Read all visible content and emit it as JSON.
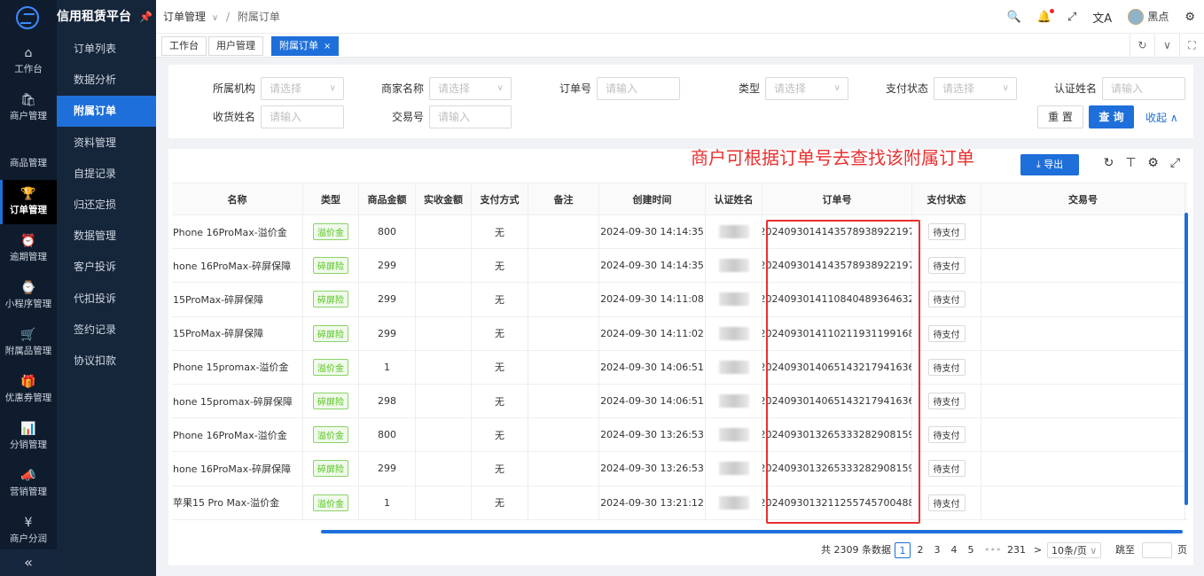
{
  "app": {
    "title": "信用租赁平台"
  },
  "rail": [
    {
      "icon": "home-icon",
      "glyph": "⌂",
      "label": "工作台"
    },
    {
      "icon": "bag-icon",
      "glyph": "🛍",
      "label": "商户管理"
    },
    {
      "icon": "apple-icon",
      "glyph": "",
      "label": "商品管理"
    },
    {
      "icon": "trophy-icon",
      "glyph": "🏆",
      "label": "订单管理",
      "active": true
    },
    {
      "icon": "alarm-icon",
      "glyph": "⏰",
      "label": "逾期管理"
    },
    {
      "icon": "watch-icon",
      "glyph": "⌚",
      "label": "小程序管理"
    },
    {
      "icon": "cart-icon",
      "glyph": "🛒",
      "label": "附属品管理"
    },
    {
      "icon": "gift-icon",
      "glyph": "🎁",
      "label": "优惠券管理"
    },
    {
      "icon": "chart-icon",
      "glyph": "📊",
      "label": "分销管理"
    },
    {
      "icon": "megaphone-icon",
      "glyph": "📣",
      "label": "营销管理"
    },
    {
      "icon": "yen-icon",
      "glyph": "¥",
      "label": "商户分润"
    }
  ],
  "rail_collapse": "«",
  "submenu": [
    "订单列表",
    "数据分析",
    "附属订单",
    "资料管理",
    "自提记录",
    "归还定损",
    "数据管理",
    "客户投诉",
    "代扣投诉",
    "签约记录",
    "协议扣款"
  ],
  "submenu_active": "附属订单",
  "breadcrumb": {
    "parent": "订单管理",
    "current": "附属订单"
  },
  "header": {
    "user": "黑点"
  },
  "tabs": [
    "工作台",
    "用户管理",
    "附属订单"
  ],
  "filter": {
    "org_label": "所属机构",
    "org_placeholder": "请选择",
    "merchant_label": "商家名称",
    "merchant_placeholder": "请选择",
    "orderno_label": "订单号",
    "orderno_placeholder": "请输入",
    "type_label": "类型",
    "type_placeholder": "请选择",
    "paystatus_label": "支付状态",
    "paystatus_placeholder": "请选择",
    "authname_label": "认证姓名",
    "authname_placeholder": "请输入",
    "receiver_label": "收货姓名",
    "receiver_placeholder": "请输入",
    "tradeno_label": "交易号",
    "tradeno_placeholder": "请输入",
    "reset": "重 置",
    "query": "查 询",
    "collapse": "收起"
  },
  "annotation": "商户可根据订单号去查找该附属订单",
  "export_label": "导出",
  "columns": [
    "名称",
    "类型",
    "商品金额",
    "实收金额",
    "支付方式",
    "备注",
    "创建时间",
    "认证姓名",
    "订单号",
    "支付状态",
    "交易号"
  ],
  "rows": [
    {
      "name": "Phone 16ProMax-溢价金",
      "type": "溢价金",
      "amount": "800",
      "paid": "",
      "pay": "无",
      "note": "",
      "time": "2024-09-30 14:14:35",
      "order": "2024093014143578938922197",
      "status": "待支付",
      "trade": ""
    },
    {
      "name": "hone 16ProMax-碎屏保障",
      "type": "碎屏险",
      "amount": "299",
      "paid": "",
      "pay": "无",
      "note": "",
      "time": "2024-09-30 14:14:35",
      "order": "2024093014143578938922197",
      "status": "待支付",
      "trade": ""
    },
    {
      "name": "15ProMax-碎屏保障",
      "type": "碎屏险",
      "amount": "299",
      "paid": "",
      "pay": "无",
      "note": "",
      "time": "2024-09-30 14:11:08",
      "order": "2024093014110840489364632",
      "status": "待支付",
      "trade": ""
    },
    {
      "name": "15ProMax-碎屏保障",
      "type": "碎屏险",
      "amount": "299",
      "paid": "",
      "pay": "无",
      "note": "",
      "time": "2024-09-30 14:11:02",
      "order": "2024093014110211931199168",
      "status": "待支付",
      "trade": ""
    },
    {
      "name": "Phone 15promax-溢价金",
      "type": "溢价金",
      "amount": "1",
      "paid": "",
      "pay": "无",
      "note": "",
      "time": "2024-09-30 14:06:51",
      "order": "2024093014065143217941636",
      "status": "待支付",
      "trade": ""
    },
    {
      "name": "hone 15promax-碎屏保障",
      "type": "碎屏险",
      "amount": "298",
      "paid": "",
      "pay": "无",
      "note": "",
      "time": "2024-09-30 14:06:51",
      "order": "2024093014065143217941636",
      "status": "待支付",
      "trade": ""
    },
    {
      "name": "Phone 16ProMax-溢价金",
      "type": "溢价金",
      "amount": "800",
      "paid": "",
      "pay": "无",
      "note": "",
      "time": "2024-09-30 13:26:53",
      "order": "2024093013265333282908159",
      "status": "待支付",
      "trade": ""
    },
    {
      "name": "hone 16ProMax-碎屏保障",
      "type": "碎屏险",
      "amount": "299",
      "paid": "",
      "pay": "无",
      "note": "",
      "time": "2024-09-30 13:26:53",
      "order": "2024093013265333282908159",
      "status": "待支付",
      "trade": ""
    },
    {
      "name": "苹果15 Pro Max-溢价金",
      "type": "溢价金",
      "amount": "1",
      "paid": "",
      "pay": "无",
      "note": "",
      "time": "2024-09-30 13:21:12",
      "order": "2024093013211255745700488",
      "status": "待支付",
      "trade": ""
    }
  ],
  "pager": {
    "total": "共 2309 条数据",
    "pages": [
      "1",
      "2",
      "3",
      "4",
      "5"
    ],
    "current": "1",
    "ellipsis": "•••",
    "last": "231",
    "next": ">",
    "size": "10条/页",
    "jump_label": "跳至",
    "jump_suffix": "页"
  }
}
